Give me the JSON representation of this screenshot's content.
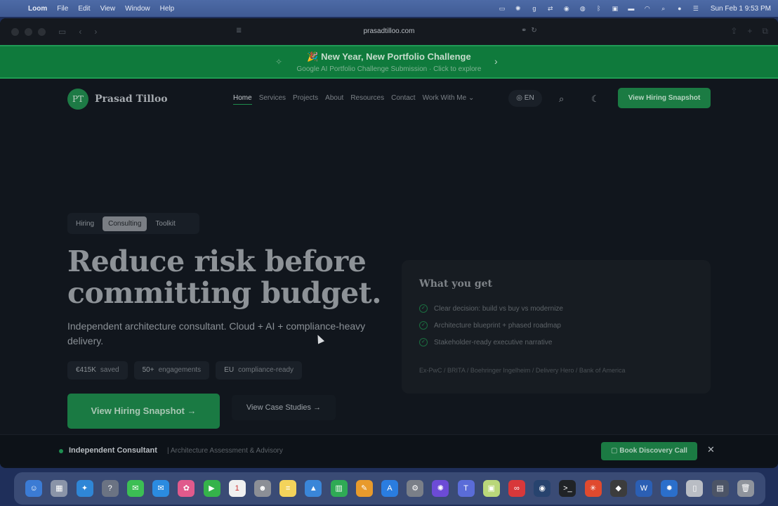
{
  "menubar": {
    "apple": "",
    "app_name": "Loom",
    "items": [
      "File",
      "Edit",
      "View",
      "Window",
      "Help"
    ],
    "clock": "Sun Feb 1  9:53 PM"
  },
  "browser": {
    "url": "prasadtilloo.com"
  },
  "promo": {
    "title": "🎉 New Year, New Portfolio Challenge",
    "subtitle": "Google AI Portfolio Challenge Submission · Click to explore"
  },
  "site": {
    "logo_initials": "PT",
    "logo_name": "Prasad Tilloo",
    "nav": [
      "Home",
      "Services",
      "Projects",
      "About",
      "Resources",
      "Contact",
      "Work With Me ⌄"
    ],
    "lang": "EN",
    "cta": "View Hiring Snapshot",
    "tabs": [
      "Hiring",
      "Consulting",
      "Toolkit"
    ],
    "headline_line1": "Reduce risk before",
    "headline_line2": "committing budget.",
    "lede": "Independent architecture consultant. Cloud + AI + compliance-heavy delivery.",
    "stats": [
      {
        "value": "€415K",
        "label": "saved"
      },
      {
        "value": "50+",
        "label": "engagements"
      },
      {
        "value": "EU",
        "label": "compliance-ready"
      }
    ],
    "primary_btn": "View Hiring Snapshot  →",
    "secondary_btn": "View Case Studies  →",
    "card_title": "What you get",
    "card_items": [
      "Clear decision: build vs buy vs modernize",
      "Architecture blueprint + phased roadmap",
      "Stakeholder-ready executive narrative"
    ],
    "clients": "Ex-PwC / BRITA / Boehringer Ingelheim / Delivery Hero / Bank of America",
    "bottom_label": "Independent Consultant",
    "bottom_tag": "| Architecture Assessment & Advisory",
    "book_btn": "Book Discovery Call"
  }
}
